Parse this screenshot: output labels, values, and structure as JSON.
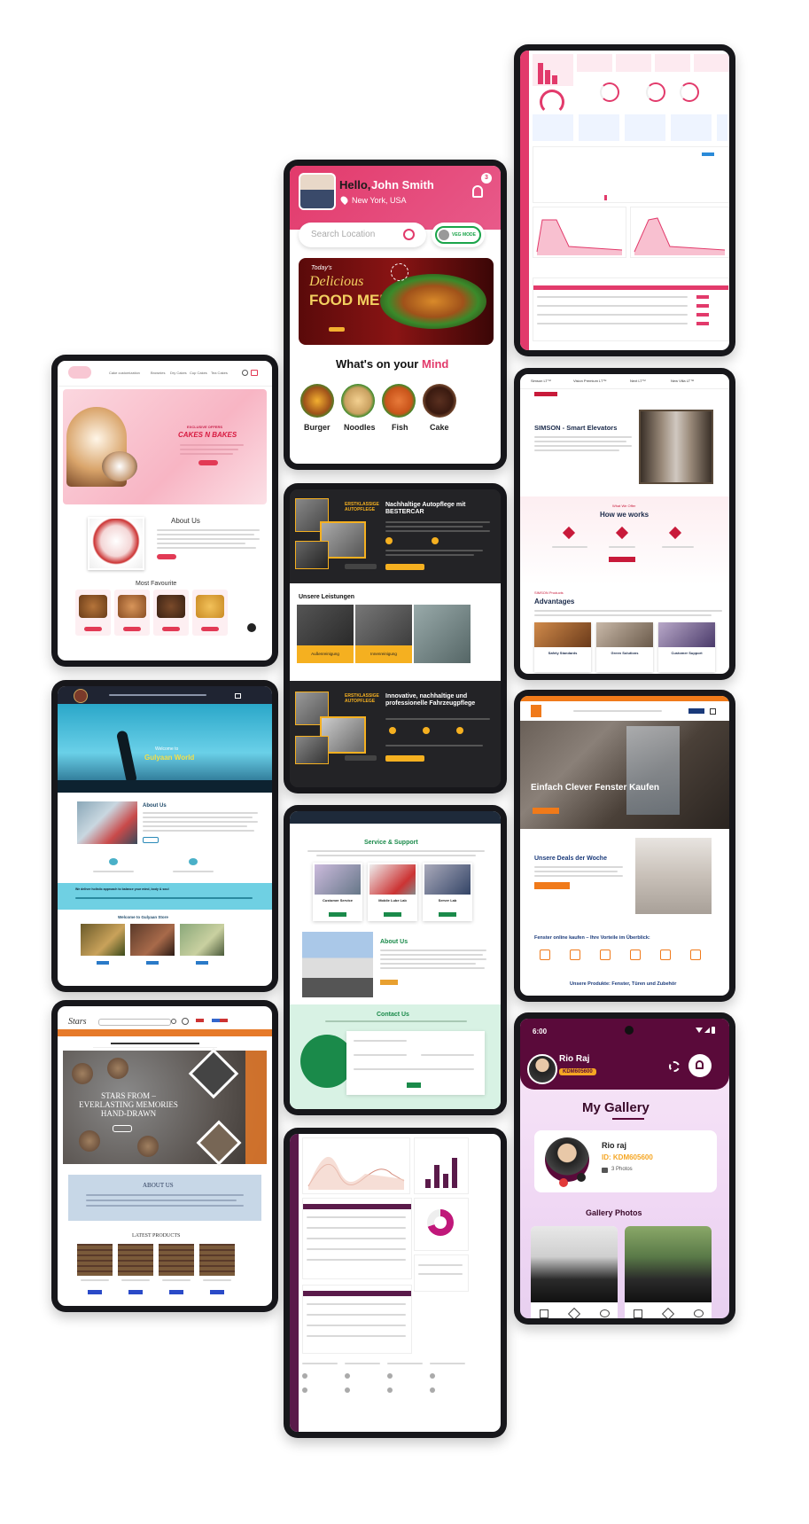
{
  "colors": {
    "pink": "#e23a6b",
    "dark": "#1e1e22",
    "orange": "#f5a623",
    "teal": "#1aa47a",
    "purple": "#5a1a4a"
  },
  "cake": {
    "nav": [
      "Cake customization",
      "Brownies",
      "Dry Cakes",
      "Cup Cakes",
      "Tea Cakes"
    ],
    "hero_kicker": "EXCLUSIVE OFFERS",
    "hero_title": "CAKES N BAKES",
    "about_title": "About Us",
    "fav_title": "Most Favourite"
  },
  "food": {
    "greeting_prefix": "Hello,",
    "user_name": "John Smith",
    "location": "New York, USA",
    "notif_count": "3",
    "search_placeholder": "Search Location",
    "veg_label": "VEG MODE",
    "banner_line1": "Today's",
    "banner_line2": "Delicious",
    "banner_line3": "FOOD MENU",
    "mind_prefix": "What's on your",
    "mind_highlight": "Mind",
    "categories": [
      "Burger",
      "Noodles",
      "Fish",
      "Cake"
    ]
  },
  "car": {
    "badge": "ERSTKLASSIGE AUTOPFLEGE",
    "title": "Nachhaltige Autopflege mit BESTERCAR",
    "services_title": "Unsere Leistungen",
    "service_labels": [
      "Außenreinigung",
      "Innenreinigung"
    ],
    "title2": "Innovative, nachhaltige und professionelle Fahrzeugpflege"
  },
  "yoga": {
    "hero_title": "Welcome to",
    "hero_name": "Gulyaan World",
    "about_title": "About Us",
    "banner_text": "We deliver holistic approach to balance your mind, body & soul",
    "products_title": "Welcome to Gulyaan Store"
  },
  "stars": {
    "logo": "Stars",
    "banner": "STARS FROM – EVERLASTING MEMORIES HAND-DRAWN",
    "about_title": "ABOUT US",
    "latest_title": "LATEST PRODUCTS"
  },
  "support": {
    "title": "Service & Support",
    "cards": [
      "Customer Service",
      "Mobile Lube Lab",
      "Server Lab"
    ],
    "about_title": "About Us",
    "contact_title": "Contact Us"
  },
  "elevator": {
    "tabs": [
      "Simson LT™",
      "Vision Premium LT™",
      "Next LT™",
      "New Villa LT™"
    ],
    "title": "SIMSON - Smart Elevators",
    "how_kicker": "What We Offer",
    "how_title": "How we works",
    "products_label": "SIMSON Products",
    "adv_title": "Advantages",
    "adv_cards": [
      "Safety Standards",
      "Green Solutions",
      "Customer Support"
    ]
  },
  "fenster": {
    "hero_title": "Einfach Clever Fenster Kaufen",
    "deal_title": "Unsere Deals der Woche",
    "online_title": "Fenster online kaufen – Ihre Vorteile im Überblick:",
    "produkte": "Unsere Produkte: Fenster, Türen und Zubehör"
  },
  "gallery": {
    "time": "6:00",
    "user_name": "Rio Raj",
    "user_id": "KDM605600",
    "title": "My Gallery",
    "profile_name": "Rio raj",
    "profile_id": "ID: KDM605600",
    "photos": "3 Photos",
    "photos_title": "Gallery Photos"
  }
}
